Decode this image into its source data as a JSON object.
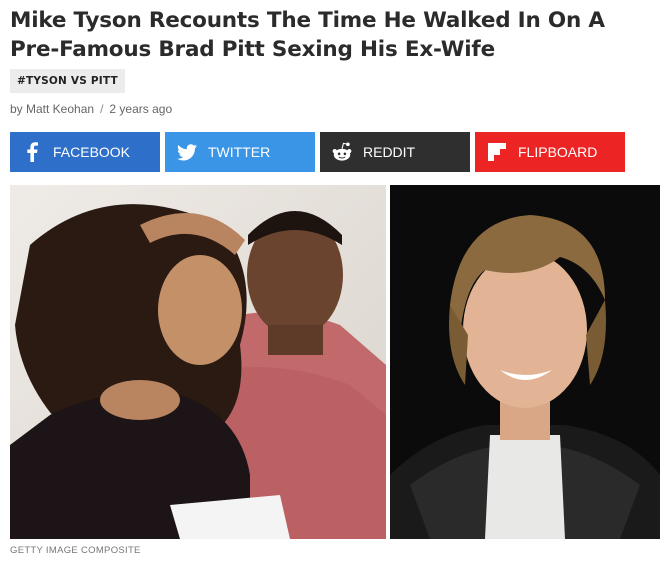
{
  "article": {
    "headline": "Mike Tyson Recounts The Time He Walked In On A Pre-Famous Brad Pitt Sexing His Ex-Wife",
    "tag": "#TYSON VS PITT",
    "author": "by Matt Keohan",
    "separator": "/",
    "time": "2 years ago"
  },
  "share": {
    "facebook": {
      "label": "FACEBOOK",
      "icon": "facebook-icon",
      "color": "#2e6fca"
    },
    "twitter": {
      "label": "TWITTER",
      "icon": "twitter-icon",
      "color": "#3b95e6"
    },
    "reddit": {
      "label": "REDDIT",
      "icon": "reddit-icon",
      "color": "#2f2f2f"
    },
    "flipboard": {
      "label": "FLIPBOARD",
      "icon": "flipboard-icon",
      "color": "#ec2424"
    }
  },
  "image": {
    "caption": "GETTY IMAGE COMPOSITE"
  }
}
